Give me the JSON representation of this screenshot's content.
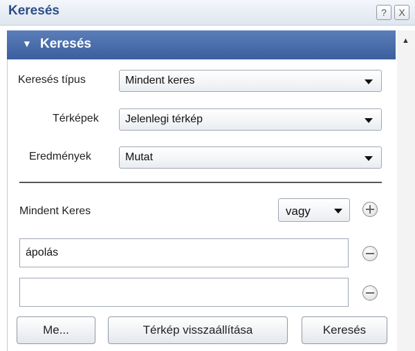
{
  "window": {
    "title": "Keresés",
    "help_label": "?",
    "close_label": "X"
  },
  "panel": {
    "header": "Keresés",
    "header_arrow": "▼"
  },
  "fields": [
    {
      "label": "Keresés típus",
      "value": "Mindent keres"
    },
    {
      "label": "Térképek",
      "value": "Jelenlegi térkép"
    },
    {
      "label": "Eredmények",
      "value": "Mutat"
    }
  ],
  "criteria": {
    "label": "Mindent Keres",
    "operator": "vagy",
    "inputs": [
      {
        "value": "ápolás",
        "placeholder": ""
      },
      {
        "value": "",
        "placeholder": ""
      }
    ]
  },
  "buttons": {
    "more": "Me...",
    "reset_map": "Térkép visszaállítása",
    "search": "Keresés"
  },
  "icons": {
    "add": "plus-circle-icon",
    "remove": "minus-circle-icon",
    "scroll_up": "arrow-up-icon"
  },
  "colors": {
    "header_bg": "#4a6ead",
    "title_text": "#2a4e87"
  }
}
